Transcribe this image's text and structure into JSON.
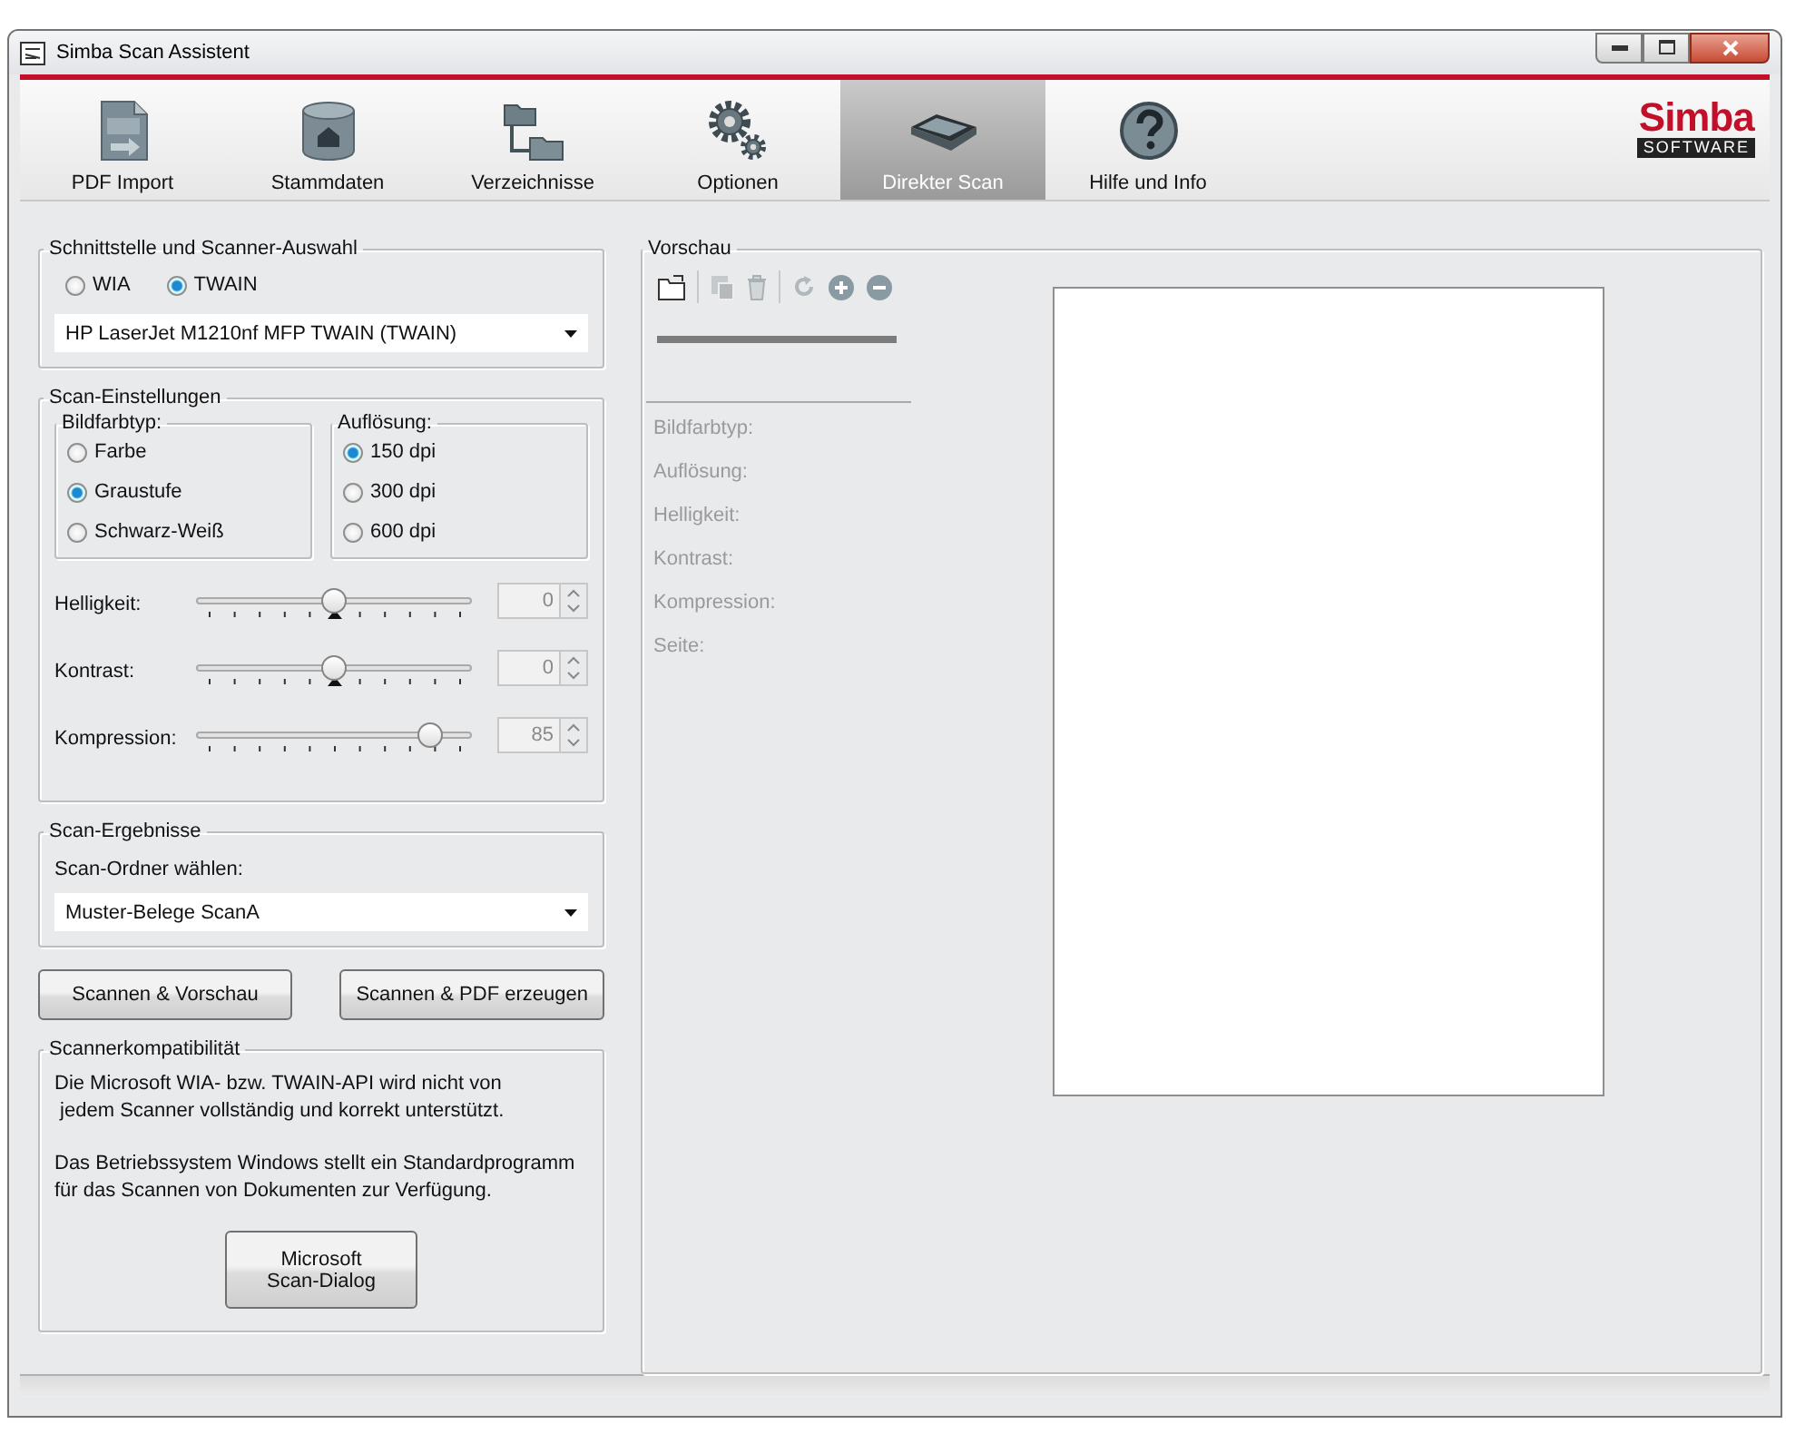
{
  "window": {
    "title": "Simba Scan Assistent"
  },
  "toolbar": {
    "items": [
      {
        "kind": "pdf",
        "label": "PDF Import",
        "selected": false
      },
      {
        "kind": "database",
        "label": "Stammdaten",
        "selected": false
      },
      {
        "kind": "folders",
        "label": "Verzeichnisse",
        "selected": false
      },
      {
        "kind": "gears",
        "label": "Optionen",
        "selected": false
      },
      {
        "kind": "scanner",
        "label": "Direkter Scan",
        "selected": true
      },
      {
        "kind": "help",
        "label": "Hilfe und Info",
        "selected": false
      }
    ]
  },
  "logo": {
    "name": "Simba",
    "sub": "SOFTWARE"
  },
  "interface": {
    "title": "Schnittstelle und Scanner-Auswahl",
    "options": [
      {
        "label": "WIA",
        "selected": false
      },
      {
        "label": "TWAIN",
        "selected": true
      }
    ],
    "scanner": "HP LaserJet M1210nf MFP TWAIN (TWAIN)"
  },
  "scan_settings": {
    "title": "Scan-Einstellungen",
    "color_type": {
      "title": "Bildfarbtyp:",
      "options": [
        {
          "label": "Farbe",
          "selected": false
        },
        {
          "label": "Graustufe",
          "selected": true
        },
        {
          "label": "Schwarz-Weiß",
          "selected": false
        }
      ]
    },
    "resolution": {
      "title": "Auflösung:",
      "options": [
        {
          "label": "150 dpi",
          "selected": true
        },
        {
          "label": "300 dpi",
          "selected": false
        },
        {
          "label": "600 dpi",
          "selected": false
        }
      ]
    },
    "sliders": [
      {
        "label": "Helligkeit:",
        "level": 0.5,
        "value": "0",
        "default_marker": true
      },
      {
        "label": "Kontrast:",
        "level": 0.5,
        "value": "0",
        "default_marker": true
      },
      {
        "label": "Kompression:",
        "level": 0.85,
        "value": "85",
        "default_marker": false
      }
    ]
  },
  "scan_results": {
    "title": "Scan-Ergebnisse",
    "folder_label": "Scan-Ordner wählen:",
    "folder": "Muster-Belege ScanA"
  },
  "buttons": [
    "Scannen & Vorschau",
    "Scannen & PDF erzeugen"
  ],
  "compatibility": {
    "title": "Scannerkompatibilität",
    "paragraphs": [
      "Die Microsoft WIA- bzw. TWAIN-API wird nicht von\n jedem Scanner vollständig und korrekt unterstützt.",
      "Das Betriebssystem Windows stellt ein Standardprogramm\nfür das Scannen von Dokumenten zur Verfügung."
    ],
    "button": "Microsoft\nScan-Dialog"
  },
  "preview": {
    "title": "Vorschau",
    "tools": [
      {
        "kind": "open",
        "disabled": false
      },
      {
        "kind": "save",
        "disabled": true
      },
      {
        "kind": "delete",
        "disabled": true
      },
      {
        "kind": "rotate",
        "disabled": true
      },
      {
        "kind": "zoom-in",
        "disabled": false
      },
      {
        "kind": "zoom-out",
        "disabled": false
      }
    ],
    "info_labels": [
      "Bildfarbtyp:",
      "Auflösung:",
      "Helligkeit:",
      "Kontrast:",
      "Kompression:",
      "Seite:"
    ]
  }
}
